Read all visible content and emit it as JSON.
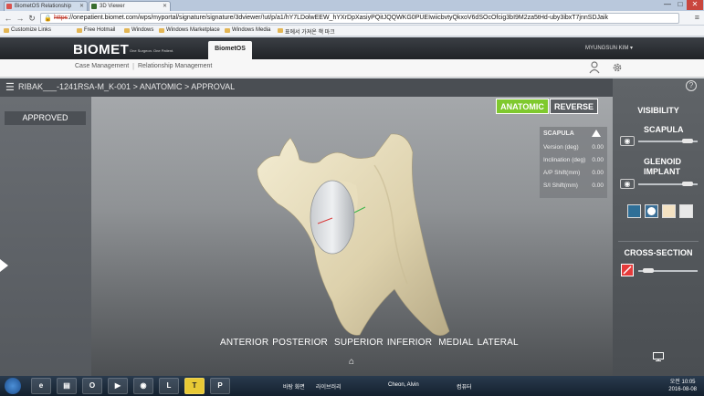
{
  "browser": {
    "tabs": [
      {
        "label": "BiometOS Relationship"
      },
      {
        "label": "3D Viewer"
      }
    ],
    "window_controls": {
      "minimize": "—",
      "maximize": "□",
      "close": "✕"
    },
    "url": {
      "scheme": "https",
      "rest": "://onepatient.biomet.com/wps/myportal/signature/signature/3dviewer/!ut/p/a1/hY7LDolwEEW_hYXrDpXasiyPQitJQQWKG0PUEIwiicbvtyQkxoV6dSOcOfcig3bI9M2za5tHd-uby3ibxT7jnnSDJaik"
    },
    "bookmarks": [
      "Customize Links",
      "Free Hotmail",
      "Windows",
      "Windows Marketplace",
      "Windows Media",
      "표에서 가져온 책 마크"
    ]
  },
  "app": {
    "brand": "BIOMET",
    "tagline": "One Surgeon. One Patient.",
    "app_tab": "BiometOS",
    "user": "MYUNGSUN KIM ▾",
    "subnav": [
      "Case Management",
      "Relationship Management"
    ]
  },
  "viewer": {
    "title": "RIBAK___-1241RSA-M_K-001 > ANATOMIC > APPROVAL",
    "approved": "APPROVED",
    "mode_buttons": {
      "anatomic": "ANATOMIC",
      "reverse": "REVERSE"
    },
    "active_mode": "anatomic",
    "scapula_panel": {
      "header": "SCAPULA",
      "rows": [
        {
          "label": "Version (deg)",
          "value": "0.00"
        },
        {
          "label": "Inclination (deg)",
          "value": "0.00"
        },
        {
          "label": "A/P Shift(mm)",
          "value": "0.00"
        },
        {
          "label": "S/I Shift(mm)",
          "value": "0.00"
        }
      ]
    },
    "view_labels": [
      "ANTERIOR",
      "POSTERIOR",
      "SUPERIOR",
      "INFERIOR",
      "MEDIAL",
      "LATERAL"
    ]
  },
  "right_panel": {
    "visibility": "VISIBILITY",
    "scapula": "SCAPULA",
    "glenoid": "GLENOID\nIMPLANT",
    "glenoid_line1": "GLENOID",
    "glenoid_line2": "IMPLANT",
    "cross_section": "CROSS-SECTION",
    "slider_scapula": 0.9,
    "slider_glenoid": 0.9,
    "slider_cross": 0.1,
    "materials": [
      "mesh",
      "solid-white",
      "texture",
      "solid-plain"
    ]
  },
  "taskbar": {
    "items": [
      {
        "name": "라이브러리"
      },
      {
        "name": "Cheon, Alvin"
      },
      {
        "name": "컴퓨터"
      }
    ],
    "tray_prefix": "바탕 화면",
    "clock_time": "오전 10:05",
    "clock_date": "2016-08-08"
  },
  "colors": {
    "accent_green": "#7fc92e",
    "cross_red": "#e63b3b",
    "header_dark": "#2a2d31"
  }
}
